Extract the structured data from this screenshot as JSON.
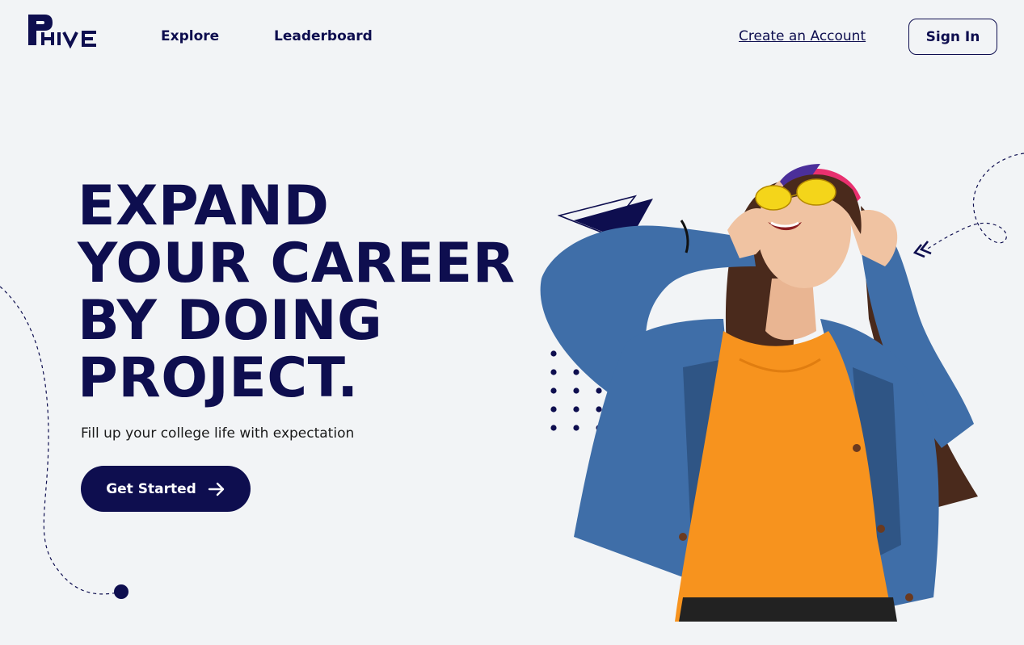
{
  "brand": {
    "logo_text": "PHIVE"
  },
  "nav": {
    "explore": "Explore",
    "leaderboard": "Leaderboard",
    "create_account": "Create an Account",
    "sign_in": "Sign In"
  },
  "hero": {
    "headline_lines": [
      "EXPAND",
      "YOUR CAREER",
      "BY DOING",
      "PROJECT."
    ],
    "subtitle": "Fill up your college life with expectation",
    "cta_label": "Get Started"
  },
  "colors": {
    "primary": "#0e0e4f",
    "background": "#f2f4f6",
    "shirt": "#f7931e",
    "denim": "#3f6ea8",
    "glasses": "#f4d51a"
  },
  "icons": {
    "cta": "arrow-right-icon",
    "deco_arrow": "double-chevron-icon"
  }
}
